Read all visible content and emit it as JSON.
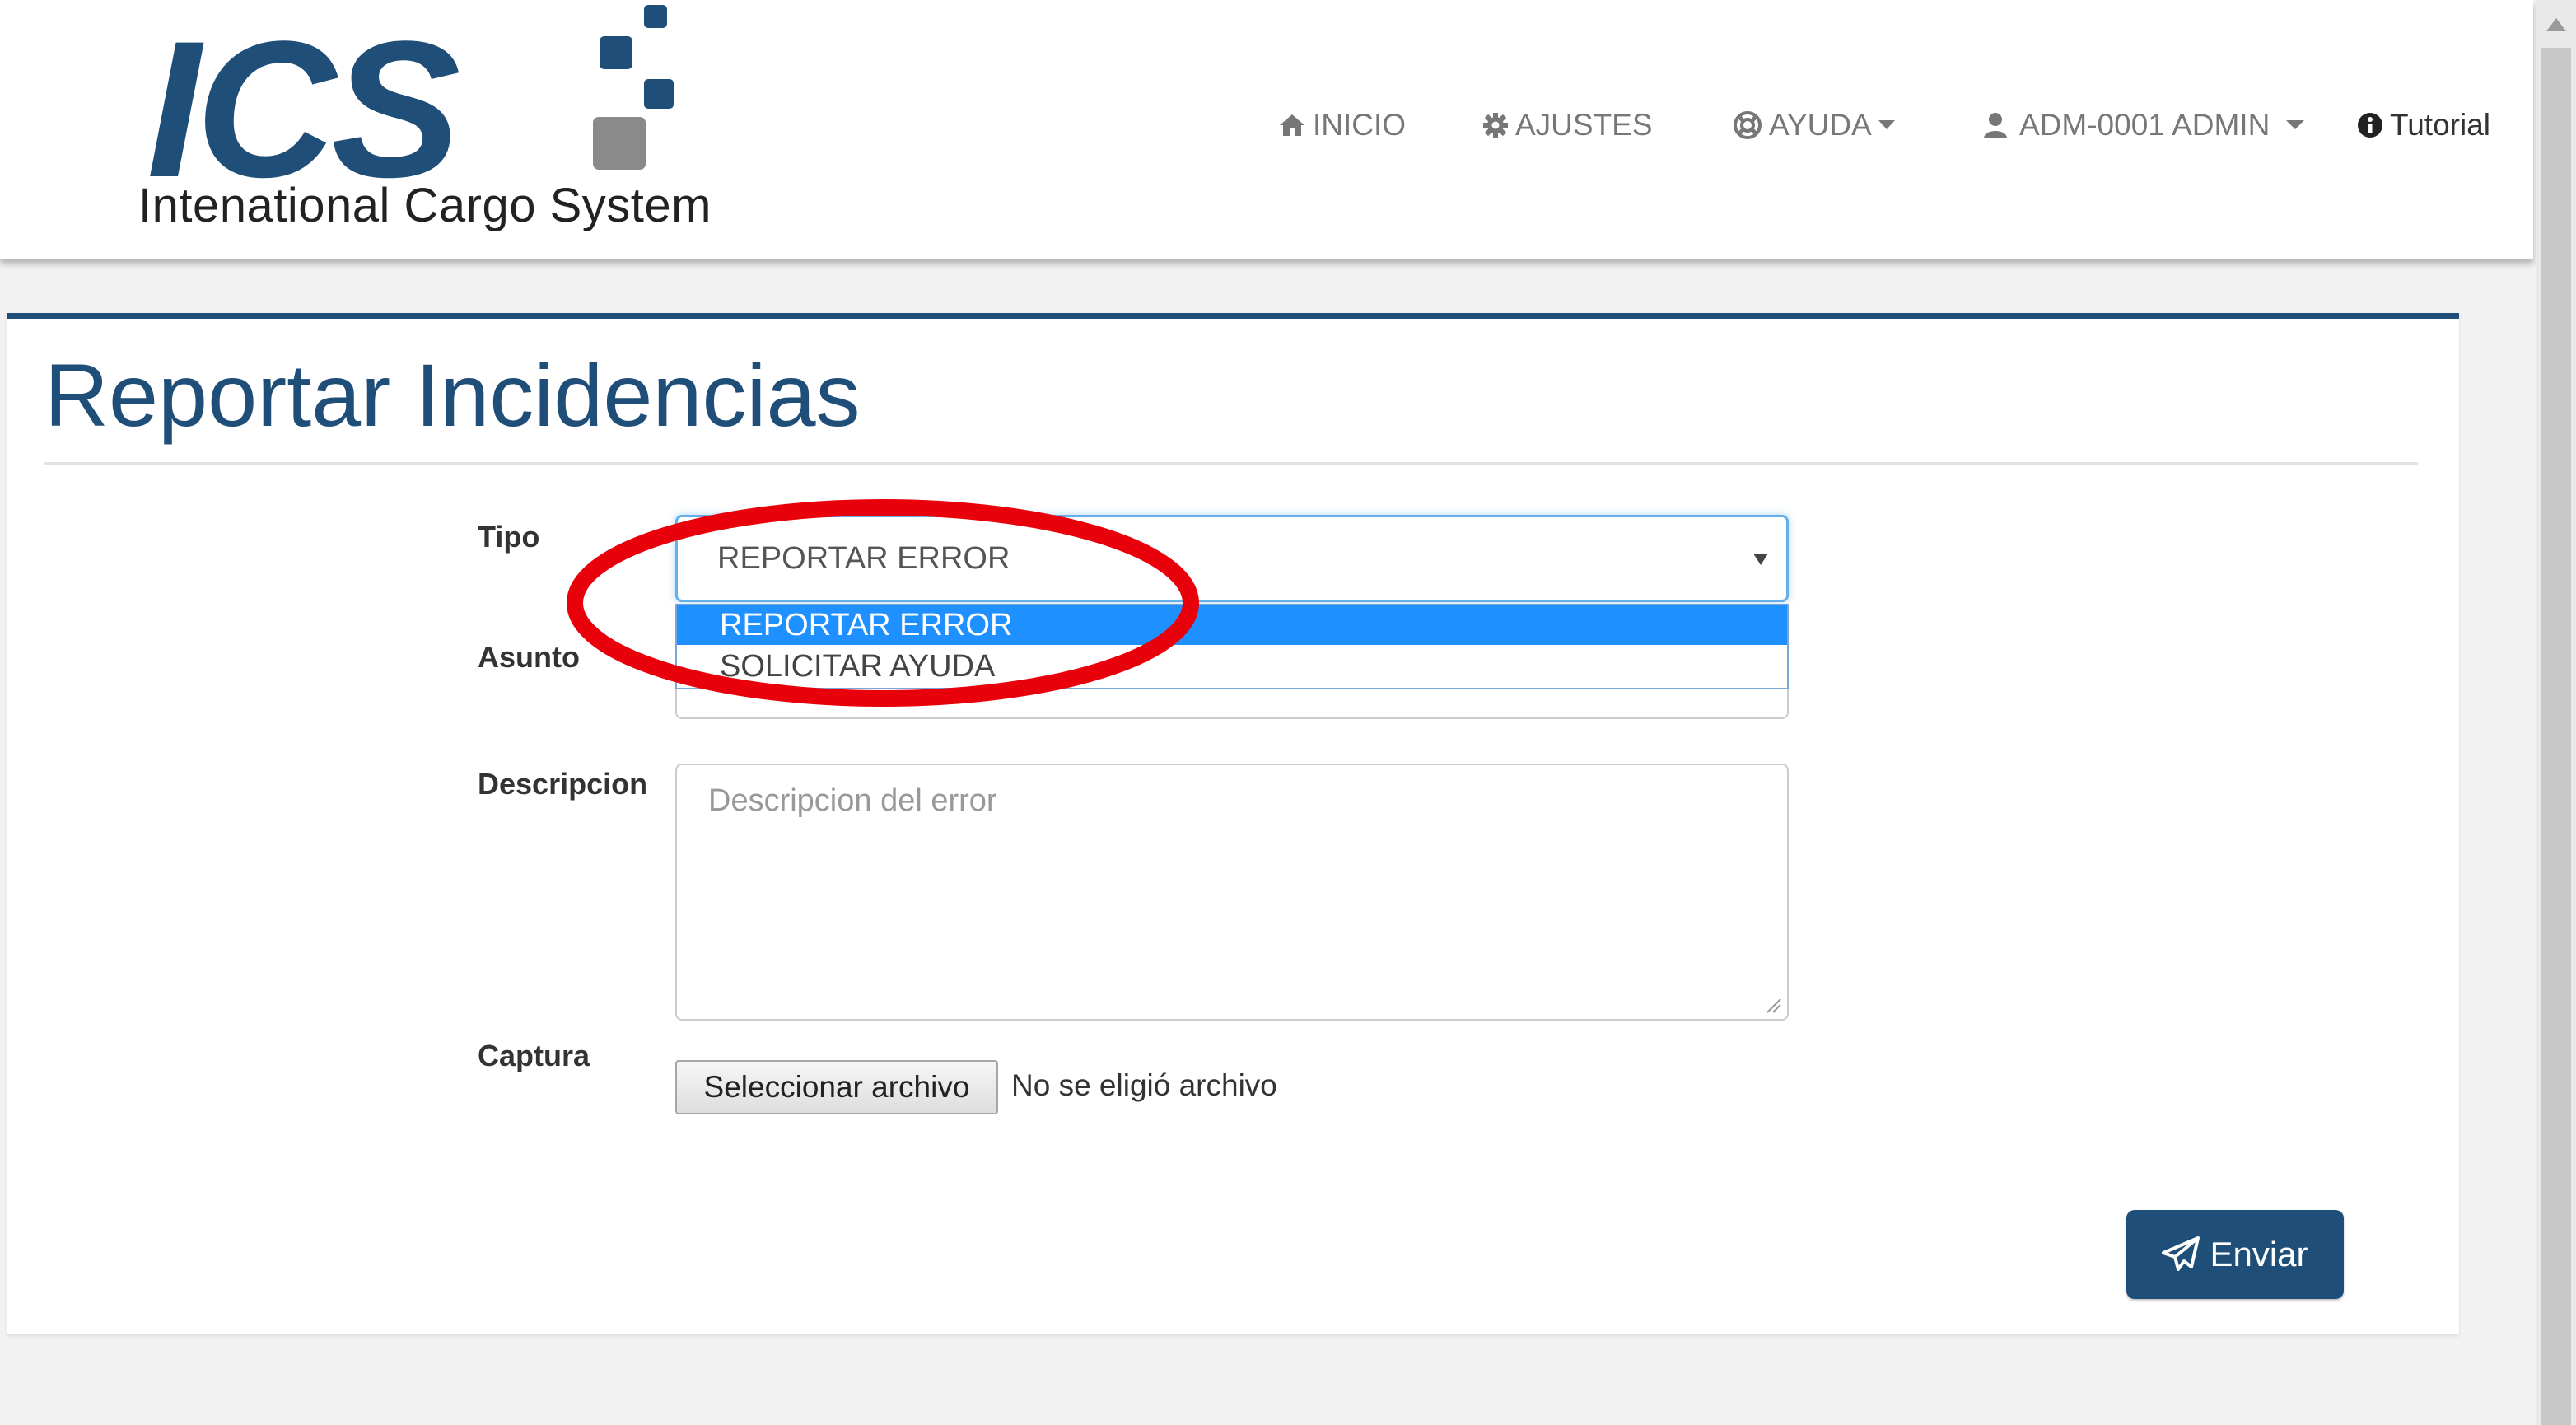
{
  "header": {
    "logo_text": "ICS",
    "logo_subtitle": "Intenational Cargo System",
    "nav": {
      "inicio": "INICIO",
      "ajustes": "AJUSTES",
      "ayuda": "AYUDA",
      "user": "ADM-0001 ADMIN",
      "tutorial": "Tutorial"
    }
  },
  "page": {
    "title": "Reportar Incidencias"
  },
  "form": {
    "tipo": {
      "label": "Tipo",
      "selected": "REPORTAR ERROR",
      "options": [
        "REPORTAR ERROR",
        "SOLICITAR AYUDA"
      ],
      "dropdown_open": true,
      "highlighted_option": "REPORTAR ERROR"
    },
    "asunto": {
      "label": "Asunto"
    },
    "descripcion": {
      "label": "Descripcion",
      "placeholder": "Descripcion del error"
    },
    "captura": {
      "label": "Captura",
      "button": "Seleccionar archivo",
      "status": "No se eligió archivo"
    },
    "submit": "Enviar"
  },
  "icons": {
    "inicio": "home-icon",
    "ajustes": "gear-icon",
    "ayuda": "lifebuoy-icon",
    "user": "user-icon",
    "tutorial": "info-icon",
    "submit": "paper-plane-icon"
  },
  "colors": {
    "brand_primary": "#1f4e79",
    "brand_accent_gray": "#8a8a8a",
    "focus_blue": "#66afe9",
    "option_highlight": "#1e90ff",
    "annotation_red": "#e8000b"
  },
  "annotation": {
    "shape": "ellipse",
    "color": "#e8000b",
    "target": "tipo dropdown options"
  }
}
